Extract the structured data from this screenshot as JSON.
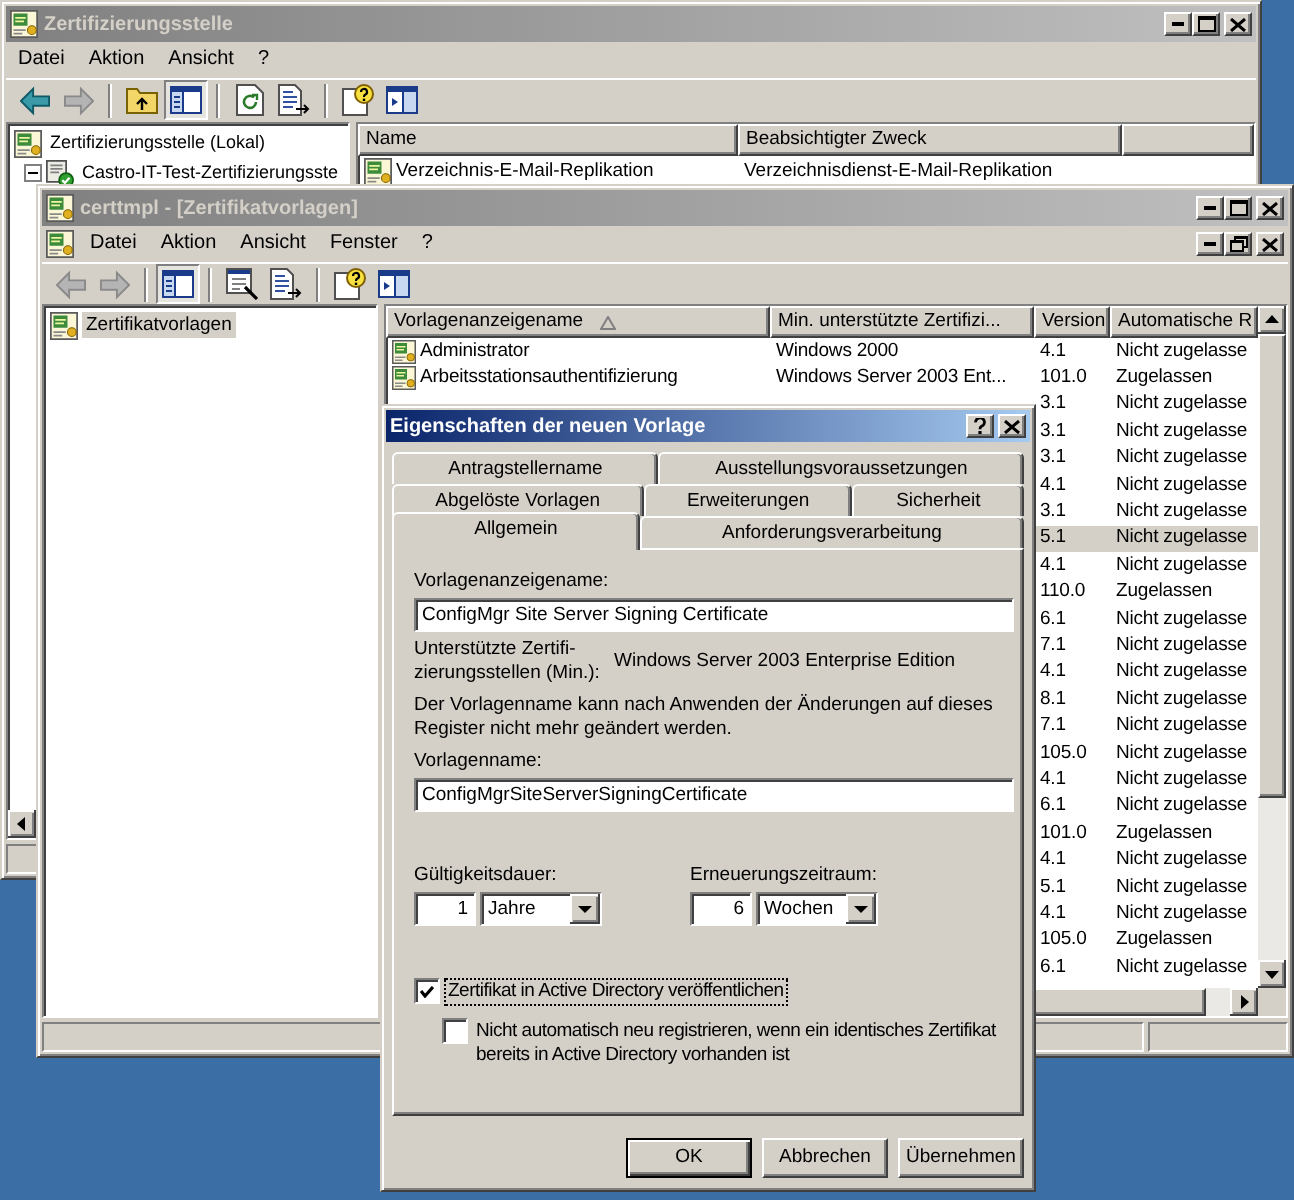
{
  "ca_window": {
    "title": "Zertifizierungsstelle",
    "active": false,
    "menu": [
      {
        "label": "Datei"
      },
      {
        "label": "Aktion"
      },
      {
        "label": "Ansicht"
      },
      {
        "label": "?"
      }
    ],
    "toolbar": [
      {
        "kind": "back",
        "disabled": false,
        "pressed": false
      },
      {
        "kind": "forward",
        "disabled": true,
        "pressed": false
      },
      {
        "kind": "separator"
      },
      {
        "kind": "up",
        "disabled": false,
        "pressed": false
      },
      {
        "kind": "tree",
        "disabled": false,
        "pressed": true
      },
      {
        "kind": "separator"
      },
      {
        "kind": "refresh",
        "disabled": false,
        "pressed": false
      },
      {
        "kind": "export",
        "disabled": false,
        "pressed": false
      },
      {
        "kind": "separator"
      },
      {
        "kind": "help",
        "disabled": false,
        "pressed": false
      },
      {
        "kind": "pane",
        "disabled": false,
        "pressed": false
      }
    ],
    "tree": [
      {
        "label": "Zertifizierungsstelle (Lokal)",
        "selected": false,
        "children": [
          {
            "label": "Castro-IT-Test-Zertifizierungsste",
            "selected": false,
            "expanded": true
          }
        ]
      }
    ],
    "list": {
      "columns": [
        {
          "label": "Name"
        },
        {
          "label": "Beabsichtigter Zweck"
        }
      ],
      "rows": [
        {
          "name": "Verzeichnis-E-Mail-Replikation",
          "purpose": "Verzeichnisdienst-E-Mail-Replikation",
          "selected": false
        }
      ]
    }
  },
  "templates_window": {
    "title": "certtmpl - [Zertifikatvorlagen]",
    "active": false,
    "menu": [
      {
        "label": "Datei"
      },
      {
        "label": "Aktion"
      },
      {
        "label": "Ansicht"
      },
      {
        "label": "Fenster"
      },
      {
        "label": "?"
      }
    ],
    "toolbar": [
      {
        "kind": "back",
        "disabled": true,
        "pressed": false
      },
      {
        "kind": "forward",
        "disabled": true,
        "pressed": false
      },
      {
        "kind": "separator"
      },
      {
        "kind": "tree",
        "disabled": false,
        "pressed": true
      },
      {
        "kind": "separator"
      },
      {
        "kind": "properties",
        "disabled": false,
        "pressed": false
      },
      {
        "kind": "export",
        "disabled": false,
        "pressed": false
      },
      {
        "kind": "separator"
      },
      {
        "kind": "help",
        "disabled": false,
        "pressed": false
      },
      {
        "kind": "pane",
        "disabled": false,
        "pressed": false
      }
    ],
    "tree": [
      {
        "label": "Zertifikatvorlagen",
        "selected": true
      }
    ],
    "list": {
      "columns": [
        {
          "label": "Vorlagenanzeigename",
          "sorted": true
        },
        {
          "label": "Min. unterstützte Zertifizi...",
          "sorted": false
        },
        {
          "label": "Version",
          "sorted": false
        },
        {
          "label": "Automatische R",
          "sorted": false
        }
      ],
      "rows": [
        {
          "name": "Administrator",
          "column_2": "Windows 2000",
          "version": "4.1",
          "column_4": "Nicht zugelasse",
          "selected": false
        },
        {
          "name": "Arbeitsstationsauthentifizierung",
          "column_2": "Windows Server 2003 Ent...",
          "version": "101.0",
          "column_4": "Zugelassen",
          "selected": false
        },
        {
          "version": "3.1",
          "column_4": "Nicht zugelasse",
          "selected": false
        },
        {
          "version": "3.1",
          "column_4": "Nicht zugelasse",
          "selected": false
        },
        {
          "version": "3.1",
          "column_4": "Nicht zugelasse",
          "selected": false
        },
        {
          "version": "4.1",
          "column_4": "Nicht zugelasse",
          "selected": false
        },
        {
          "version": "3.1",
          "column_4": "Nicht zugelasse",
          "selected": false
        },
        {
          "version": "5.1",
          "column_4": "Nicht zugelasse",
          "selected": true
        },
        {
          "version": "4.1",
          "column_4": "Nicht zugelasse",
          "selected": false
        },
        {
          "version": "110.0",
          "column_4": "Zugelassen",
          "selected": false
        },
        {
          "version": "6.1",
          "column_4": "Nicht zugelasse",
          "selected": false
        },
        {
          "version": "7.1",
          "column_4": "Nicht zugelasse",
          "selected": false
        },
        {
          "version": "4.1",
          "column_4": "Nicht zugelasse",
          "selected": false
        },
        {
          "version": "8.1",
          "column_4": "Nicht zugelasse",
          "selected": false
        },
        {
          "version": "7.1",
          "column_4": "Nicht zugelasse",
          "selected": false
        },
        {
          "version": "105.0",
          "column_4": "Nicht zugelasse",
          "selected": false
        },
        {
          "version": "4.1",
          "column_4": "Nicht zugelasse",
          "selected": false
        },
        {
          "version": "6.1",
          "column_4": "Nicht zugelasse",
          "selected": false
        },
        {
          "version": "101.0",
          "column_4": "Zugelassen",
          "selected": false
        },
        {
          "version": "4.1",
          "column_4": "Nicht zugelasse",
          "selected": false
        },
        {
          "version": "5.1",
          "column_4": "Nicht zugelasse",
          "selected": false
        },
        {
          "version": "4.1",
          "column_4": "Nicht zugelasse",
          "selected": false
        },
        {
          "version": "105.0",
          "column_4": "Zugelassen",
          "selected": false
        },
        {
          "version": "6.1",
          "column_4": "Nicht zugelasse",
          "selected": false
        }
      ]
    }
  },
  "dialog": {
    "title": "Eigenschaften der neuen Vorlage",
    "active": true,
    "tab_rows": [
      [
        {
          "label": "Antragstellername",
          "selected": false
        },
        {
          "label": "Ausstellungsvoraussetzungen",
          "selected": false
        }
      ],
      [
        {
          "label": "Abgelöste Vorlagen",
          "selected": false
        },
        {
          "label": "Erweiterungen",
          "selected": false
        },
        {
          "label": "Sicherheit",
          "selected": false
        }
      ],
      [
        {
          "label": "Allgemein",
          "selected": true
        },
        {
          "label": "Anforderungsverarbeitung",
          "selected": false
        }
      ]
    ],
    "display_name": {
      "label": "Vorlagenanzeigename:",
      "value": "ConfigMgr Site Server Signing Certificate"
    },
    "min_ca": {
      "label": "Unterstützte Zertifi-\nzierungsstellen (Min.):",
      "value": "Windows Server 2003 Enterprise Edition"
    },
    "note": "Der Vorlagenname kann nach Anwenden der Änderungen auf dieses Register nicht mehr geändert werden.",
    "template_name": {
      "label": "Vorlagenname:",
      "value": "ConfigMgrSiteServerSigningCertificate"
    },
    "validity": {
      "label": "Gültigkeitsdauer:",
      "number": "1",
      "unit": "Jahre"
    },
    "renewal": {
      "label": "Erneuerungszeitraum:",
      "number": "6",
      "unit": "Wochen"
    },
    "checkboxes": [
      {
        "label": "Zertifikat in Active Directory veröffentlichen",
        "checked": true,
        "focused": true,
        "children": [
          {
            "label": "Nicht automatisch neu registrieren, wenn ein identisches Zertifikat bereits in Active Directory vorhanden ist",
            "checked": false,
            "focused": false
          }
        ]
      }
    ],
    "buttons": [
      {
        "label": "OK",
        "default": true
      },
      {
        "label": "Abbrechen",
        "default": false
      },
      {
        "label": "Übernehmen",
        "default": false
      }
    ]
  }
}
